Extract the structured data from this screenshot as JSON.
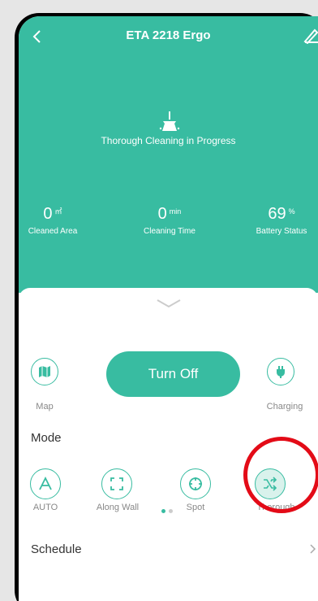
{
  "header": {
    "title": "ETA 2218 Ergo"
  },
  "status": {
    "text": "Thorough Cleaning in Progress"
  },
  "stats": [
    {
      "value": "0",
      "unit": "㎡",
      "label": "Cleaned Area"
    },
    {
      "value": "0",
      "unit": "min",
      "label": "Cleaning Time"
    },
    {
      "value": "69",
      "unit": "%",
      "label": "Battery Status"
    }
  ],
  "controls": {
    "map_label": "Map",
    "turn_off_label": "Turn Off",
    "charging_label": "Charging"
  },
  "mode": {
    "title": "Mode",
    "items": [
      {
        "label": "AUTO",
        "icon": "auto-icon"
      },
      {
        "label": "Along Wall",
        "icon": "along-wall-icon"
      },
      {
        "label": "Spot",
        "icon": "spot-icon"
      },
      {
        "label": "Thorough",
        "icon": "shuffle-icon"
      }
    ],
    "page_indicator": {
      "current": 1,
      "total": 2
    }
  },
  "schedule": {
    "label": "Schedule"
  },
  "colors": {
    "accent": "#38bca1",
    "highlight": "#e30b17"
  }
}
